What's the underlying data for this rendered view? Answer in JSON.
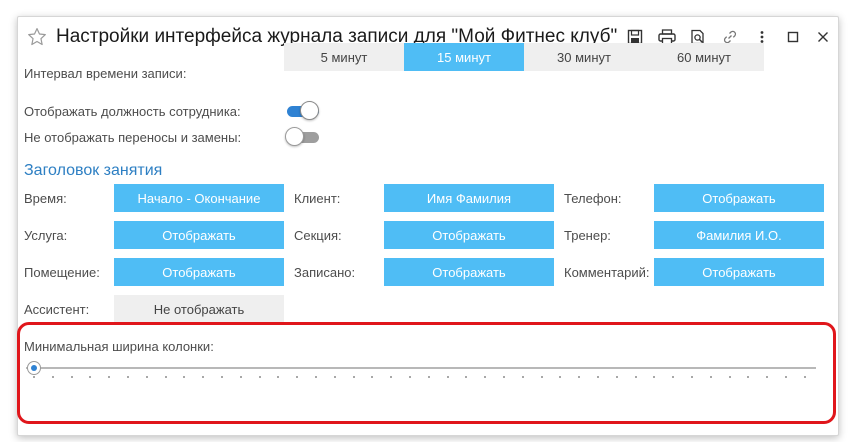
{
  "window": {
    "title": "Настройки интерфейса журнала записи для \"Мой Фитнес клуб\"",
    "icons": [
      "star-icon",
      "save-icon",
      "print-icon",
      "preview-icon",
      "link-icon",
      "more-icon",
      "maximize-icon",
      "close-icon"
    ]
  },
  "interval": {
    "label": "Интервал времени записи:",
    "options": [
      "5 минут",
      "15 минут",
      "30 минут",
      "60 минут"
    ],
    "selected": "15 минут"
  },
  "toggles": {
    "show_position": {
      "label": "Отображать должность сотрудника:",
      "on": true
    },
    "hide_transfers": {
      "label": "Не отображать переносы и замены:",
      "on": false
    }
  },
  "lesson_header": {
    "title": "Заголовок занятия",
    "fields": {
      "time": {
        "label": "Время:",
        "value": "Начало - Окончание"
      },
      "client": {
        "label": "Клиент:",
        "value": "Имя Фамилия"
      },
      "phone": {
        "label": "Телефон:",
        "value": "Отображать"
      },
      "service": {
        "label": "Услуга:",
        "value": "Отображать"
      },
      "section": {
        "label": "Секция:",
        "value": "Отображать"
      },
      "trainer": {
        "label": "Тренер:",
        "value": "Фамилия И.О."
      },
      "room": {
        "label": "Помещение:",
        "value": "Отображать"
      },
      "enrolled": {
        "label": "Записано:",
        "value": "Отображать"
      },
      "comment": {
        "label": "Комментарий:",
        "value": "Отображать"
      },
      "assistant": {
        "label": "Ассистент:",
        "value": "Не отображать"
      }
    }
  },
  "min_width": {
    "label": "Минимальная ширина колонки:",
    "slider_fraction": 0
  },
  "colors": {
    "accent": "#4fbdf5",
    "toggle_on": "#2f82d3",
    "section_title": "#2d7fc3",
    "highlight": "#e0161b"
  }
}
